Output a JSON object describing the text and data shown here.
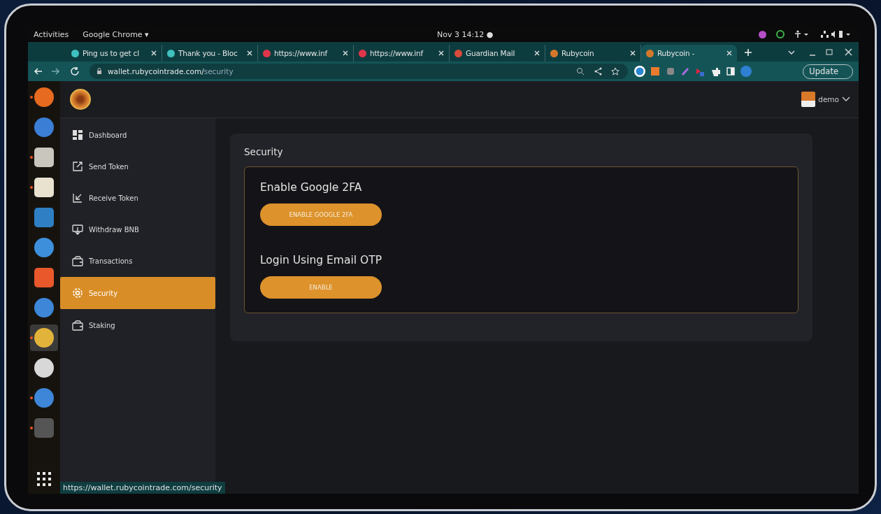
{
  "top_bar": {
    "activities": "Activities",
    "app_menu": "Google Chrome",
    "app_menu_caret": "▾",
    "clock": "Nov 3  14:12",
    "clock_dot": "●"
  },
  "tabs": [
    {
      "title": "Ping us to get cl",
      "kind": "gem",
      "selected": false
    },
    {
      "title": "Thank you - Bloc",
      "kind": "gem",
      "selected": false
    },
    {
      "title": "https://www.inf",
      "kind": "red",
      "selected": false
    },
    {
      "title": "https://www.inf",
      "kind": "red",
      "selected": false
    },
    {
      "title": "Guardian Mail",
      "kind": "mail",
      "selected": false
    },
    {
      "title": "Rubycoin",
      "kind": "coin",
      "selected": false
    },
    {
      "title": "Rubycoin -",
      "kind": "coin",
      "selected": true
    }
  ],
  "toolbar": {
    "address": "wallet.rubycointrade.com/",
    "address_path": "security",
    "update_button": "Update"
  },
  "dock": [
    {
      "kind": "fox",
      "running": true,
      "selected": false
    },
    {
      "kind": "bird",
      "running": false,
      "selected": false
    },
    {
      "kind": "files",
      "running": true,
      "selected": false
    },
    {
      "kind": "speaker",
      "running": true,
      "selected": false
    },
    {
      "kind": "doc",
      "running": false,
      "selected": false
    },
    {
      "kind": "help",
      "running": false,
      "selected": false
    },
    {
      "kind": "store",
      "running": false,
      "selected": false
    },
    {
      "kind": "ring",
      "running": false,
      "selected": false
    },
    {
      "kind": "chrome",
      "running": true,
      "selected": true
    },
    {
      "kind": "update",
      "running": false,
      "selected": false
    },
    {
      "kind": "ring",
      "running": true,
      "selected": false
    },
    {
      "kind": "terminal",
      "running": true,
      "selected": false
    }
  ],
  "site": {
    "user": "demo",
    "nav": [
      {
        "label": "Dashboard",
        "kind": "grid",
        "selected": false
      },
      {
        "label": "Send Token",
        "kind": "send",
        "selected": false
      },
      {
        "label": "Receive Token",
        "kind": "receive",
        "selected": false
      },
      {
        "label": "Withdraw BNB",
        "kind": "withdraw",
        "selected": false
      },
      {
        "label": "Transactions",
        "kind": "wallet",
        "selected": false
      },
      {
        "label": "Security",
        "kind": "gear",
        "selected": true
      },
      {
        "label": "Staking",
        "kind": "wallet",
        "selected": false
      }
    ],
    "panel_title": "Security",
    "sections": [
      {
        "heading": "Enable Google 2FA",
        "button": "ENABLE GOOGLE 2FA"
      },
      {
        "heading": "Login Using Email OTP",
        "button": "ENABLE"
      }
    ]
  },
  "status_url": "https://wallet.rubycointrade.com/security"
}
